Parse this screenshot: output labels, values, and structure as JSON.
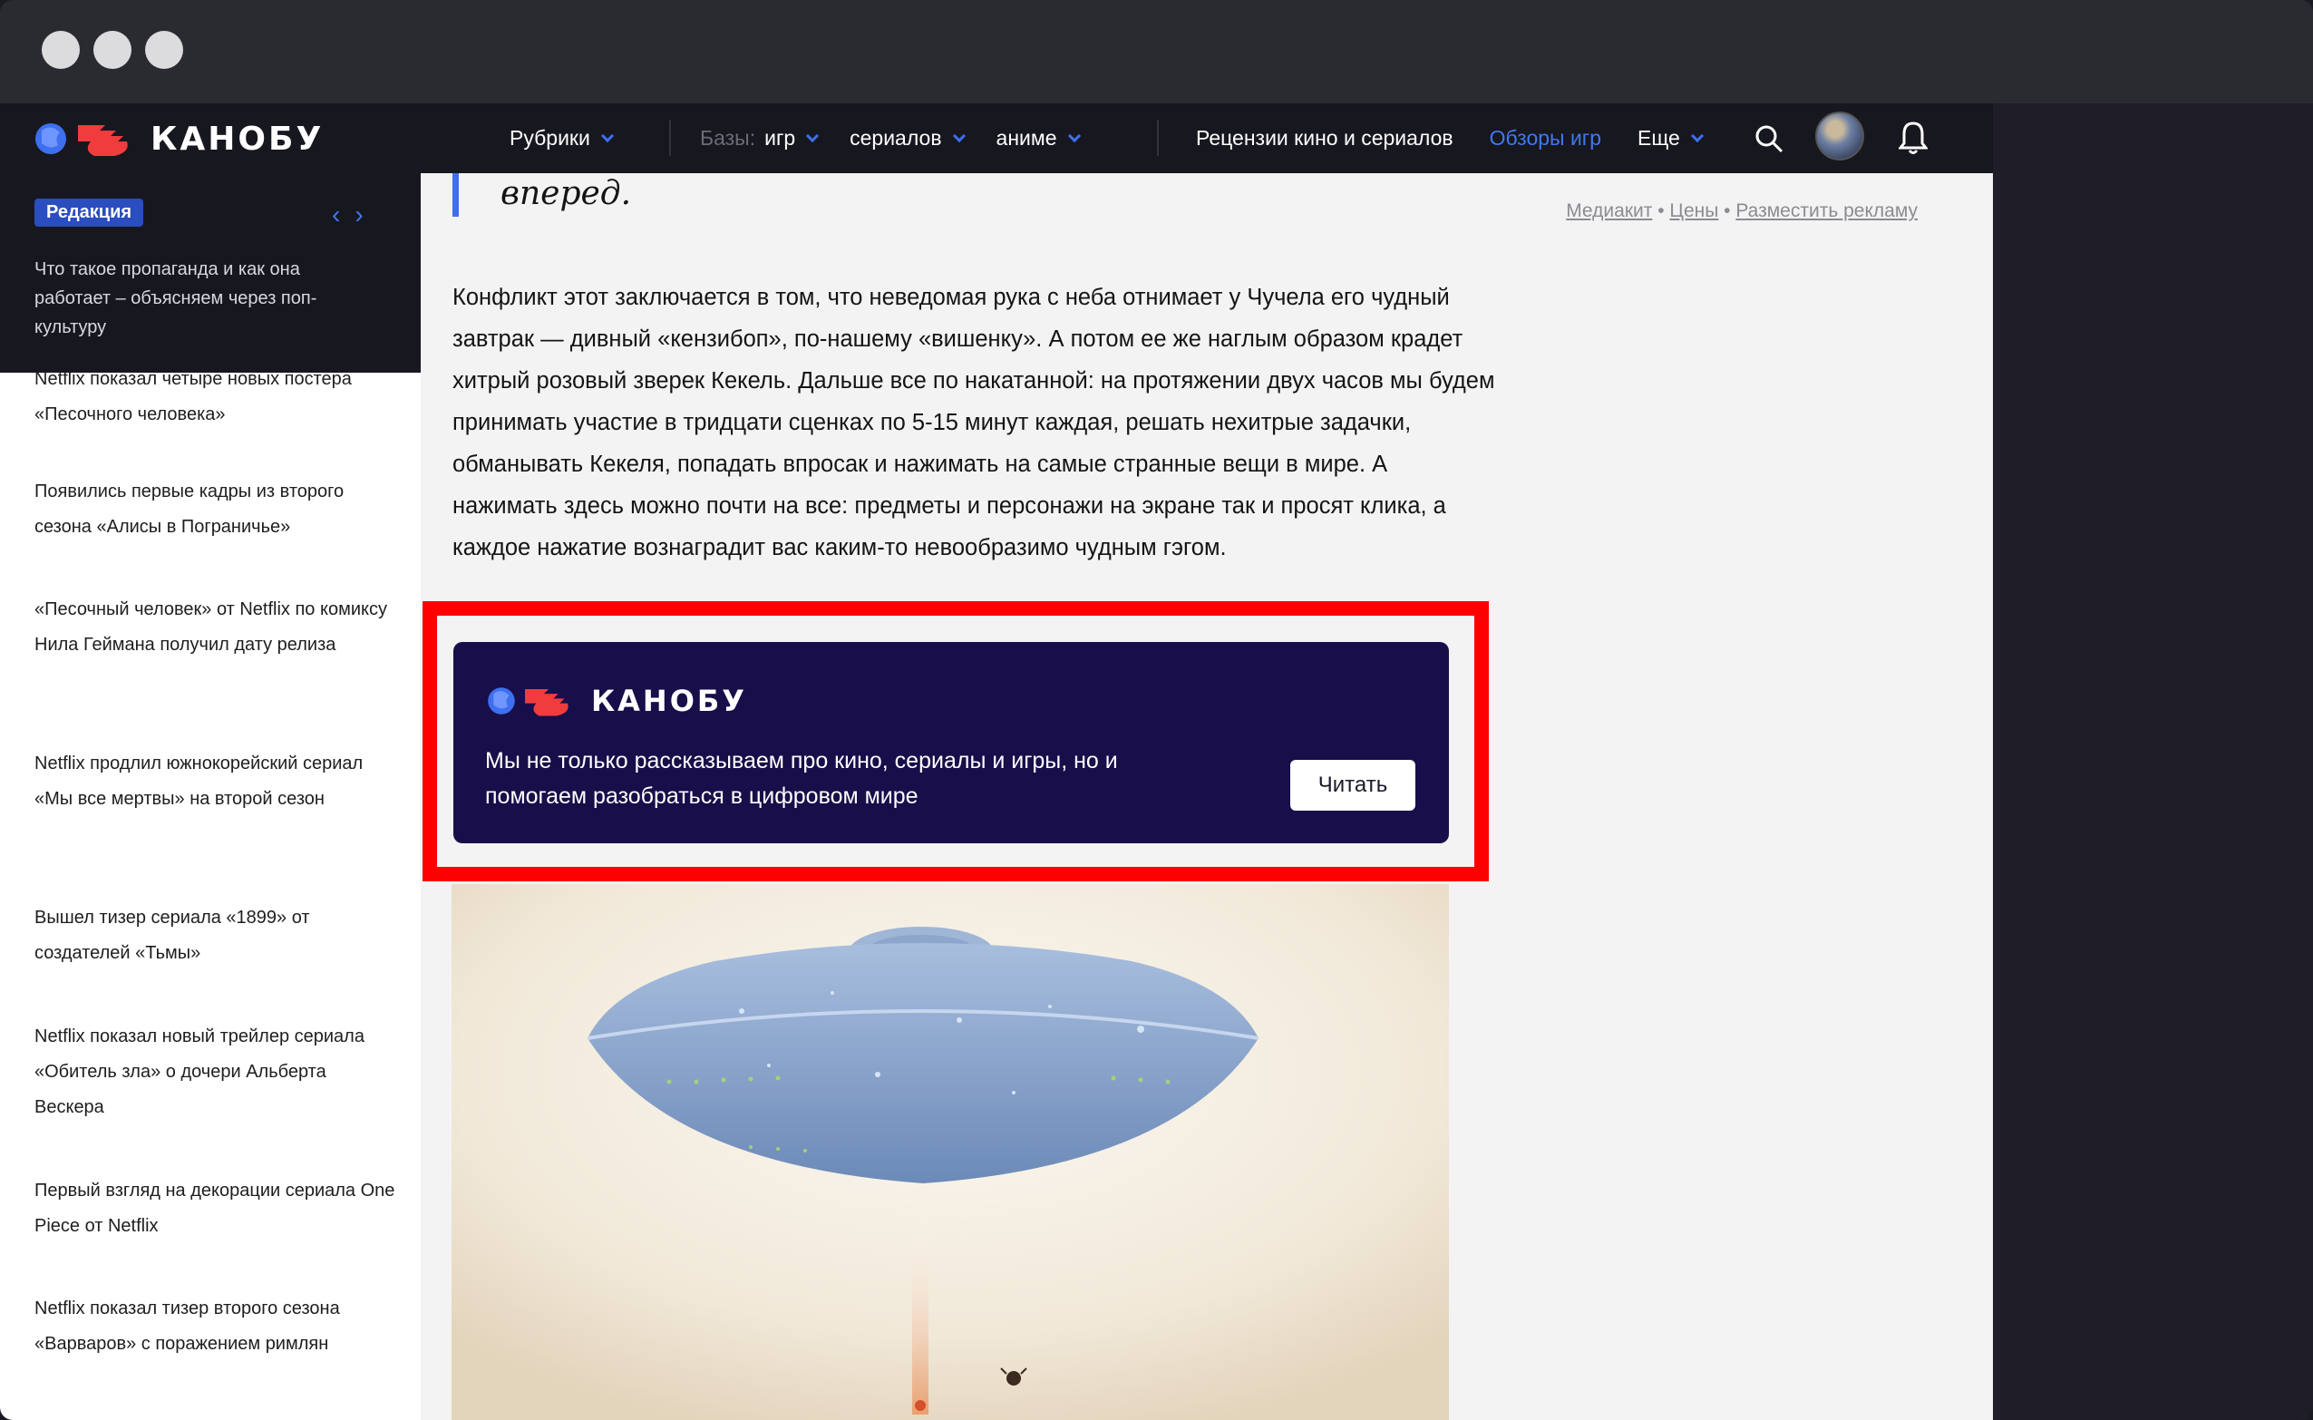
{
  "header": {
    "logo_text": "КАНОБУ",
    "rubrics": "Рубрики",
    "bases_prefix": "Базы:",
    "bases_games": "игр",
    "bases_series": "сериалов",
    "bases_anime": "аниме",
    "reviews_movies": "Рецензии кино и сериалов",
    "reviews_games": "Обзоры игр",
    "more": "Еще"
  },
  "sidebar": {
    "badge": "Редакция",
    "featured": "Что такое пропаганда и как она работает – объясняем через поп-культуру",
    "items": [
      "Netflix показал четыре новых постера «Песочного человека»",
      "Появились первые кадры из второго сезона «Алисы в Пограничье»",
      "«Песочный человек» от Netflix по комиксу Нила Геймана получил дату релиза",
      "Netflix продлил южнокорейский сериал «Мы все мертвы» на второй сезон",
      "Вышел тизер сериала «1899» от создателей «Тьмы»",
      "Netflix показал новый трейлер сериала «Обитель зла» о дочери Альберта Вескера",
      "Первый взгляд на декорации сериала One Piece от Netflix",
      "Netflix показал тизер второго сезона «Варваров» с поражением римлян"
    ]
  },
  "article": {
    "quote": "вперед.",
    "links": [
      "Медиакит",
      "Цены",
      "Разместить рекламу"
    ],
    "link_separator": "•",
    "paragraph": "Конфликт этот заключается в том, что неведомая рука с неба отнимает у Чучела его чудный завтрак — дивный «кензибоп», по-нашему «вишенку». А потом ее же наглым образом крадет хитрый розовый зверек Кекель. Дальше все по накатанной: на протяжении двух часов мы будем принимать участие в тридцати сценках по 5-15 минут каждая, решать нехитрые задачки, обманывать Кекеля, попадать впросак и нажимать на самые странные вещи в мире. А нажимать здесь можно почти на все: предметы и персонажи на экране так и просят клика, а каждое нажатие вознаградит вас каким-то невообразимо чудным гэгом."
  },
  "promo": {
    "logo_text": "КАНОБУ",
    "text": "Мы не только рассказываем про кино, сериалы и игры, но и помогаем разобраться в цифровом мире",
    "button": "Читать"
  },
  "colors": {
    "accent": "#3d6ff0",
    "header_bg": "#17171f",
    "promo_bg": "#180e4a",
    "highlight": "#ff0000"
  }
}
